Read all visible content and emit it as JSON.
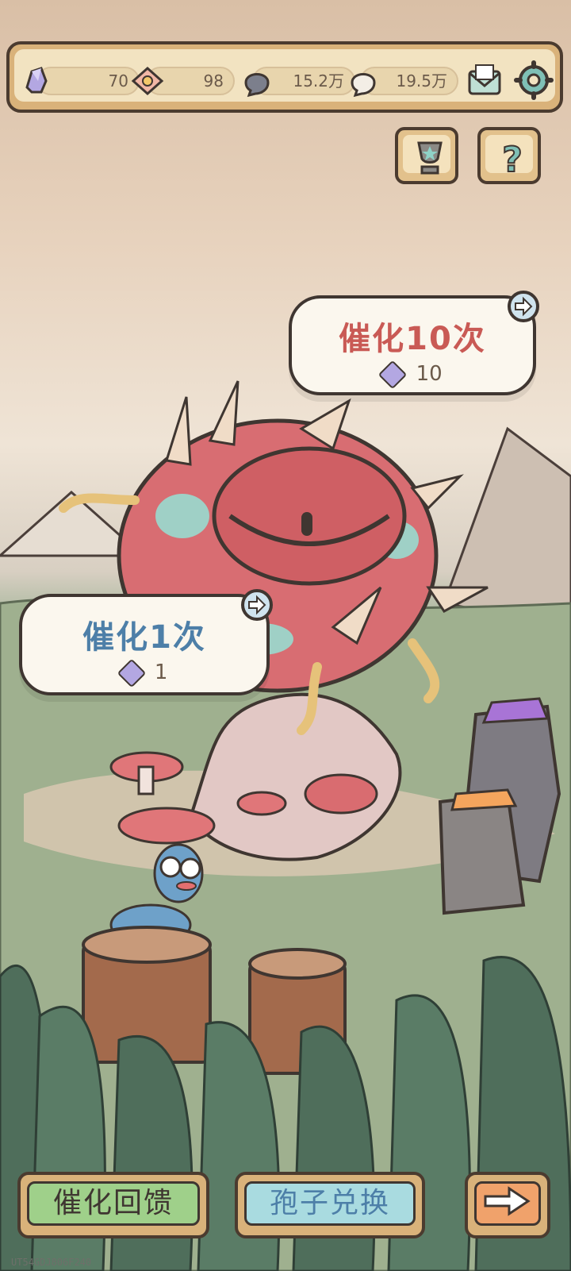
{
  "currencies": {
    "crystal": {
      "value": "70",
      "icon": "crystal-icon"
    },
    "ticket": {
      "value": "98",
      "icon": "ticket-icon"
    },
    "dark_spore": {
      "value": "15.2万",
      "icon": "dark-spore-icon"
    },
    "light_spore": {
      "value": "19.5万",
      "icon": "light-spore-icon"
    }
  },
  "catalyze_10": {
    "label": "催化10次",
    "cost": "10"
  },
  "catalyze_1": {
    "label": "催化1次",
    "cost": "1"
  },
  "buttons": {
    "feedback": "催化回馈",
    "spore_exchange": "孢子兑换"
  },
  "footer": {
    "code": "UT54GDJ806F240"
  },
  "colors": {
    "bubble_title_red": "#c95a55",
    "bubble_title_blue": "#4d7fa8",
    "feedback_green": "#9fd08a",
    "exchange_teal": "#a9dbe0",
    "arrow_orange": "#f0a26b"
  }
}
